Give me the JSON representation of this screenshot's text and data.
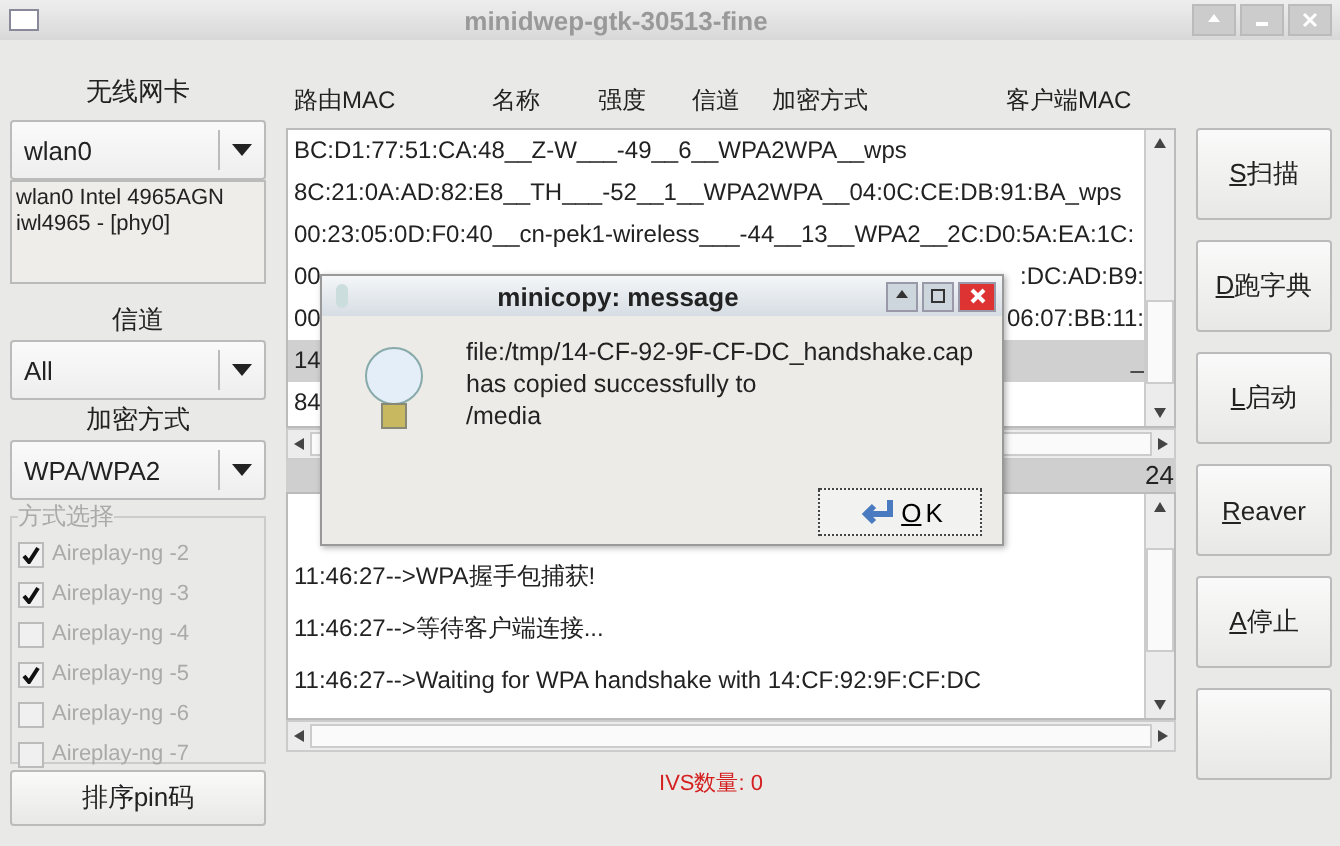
{
  "window": {
    "title": "minidwep-gtk-30513-fine"
  },
  "sidebar": {
    "adapter_label": "无线网卡",
    "adapter": "wlan0",
    "adapter_info": [
      "wlan0 Intel 4965AGN",
      "iwl4965 - [phy0]"
    ],
    "channel_label": "信道",
    "channel": "All",
    "encryption_label": "加密方式",
    "encryption": "WPA/WPA2",
    "methods_label": "方式选择",
    "methods": [
      {
        "label": "Aireplay-ng -2",
        "checked": true,
        "disabled": true
      },
      {
        "label": "Aireplay-ng -3",
        "checked": true,
        "disabled": true
      },
      {
        "label": "Aireplay-ng -4",
        "checked": false,
        "disabled": true
      },
      {
        "label": "Aireplay-ng -5",
        "checked": true,
        "disabled": true
      },
      {
        "label": "Aireplay-ng -6",
        "checked": false,
        "disabled": true
      },
      {
        "label": "Aireplay-ng -7",
        "checked": false,
        "disabled": true
      }
    ],
    "pin_button": "排序pin码"
  },
  "table": {
    "columns": [
      "路由MAC",
      "名称",
      "强度",
      "信道",
      "加密方式",
      "客户端MAC"
    ],
    "rows": [
      {
        "text": "BC:D1:77:51:CA:48__Z-W___-49__6__WPA2WPA__wps",
        "selected": false
      },
      {
        "text": "8C:21:0A:AD:82:E8__TH___-52__1__WPA2WPA__04:0C:CE:DB:91:BA_wps",
        "selected": false
      },
      {
        "text": "00:23:05:0D:F0:40__cn-pek1-wireless___-44__13__WPA2__2C:D0:5A:EA:1C:",
        "selected": false
      },
      {
        "text": "00",
        "tail": ":DC:AD:B9:",
        "selected": false
      },
      {
        "text": "00",
        "tail": "06:07:BB:11:",
        "selected": false
      },
      {
        "text": "14",
        "tail": "_",
        "selected": true
      },
      {
        "text": "84",
        "selected": false
      }
    ]
  },
  "counter": "24",
  "log": {
    "lines": [
      "11:46:27-->WPA握手包捕获!",
      "11:46:27-->等待客户端连接...",
      "11:46:27-->Waiting for WPA handshake with 14:CF:92:9F:CF:DC"
    ]
  },
  "buttons": [
    {
      "key": "S",
      "label": "扫描"
    },
    {
      "key": "D",
      "label": "跑字典"
    },
    {
      "key": "L",
      "label": "启动"
    },
    {
      "key": "R",
      "label": "eaver"
    },
    {
      "key": "A",
      "label": "停止"
    }
  ],
  "status_bar": {
    "ivs": "IVS数量: 0"
  },
  "dialog": {
    "title": "minicopy: message",
    "message": [
      "file:/tmp/14-CF-92-9F-CF-DC_handshake.cap",
      "has copied successfully to",
      "/media"
    ],
    "ok": {
      "key": "O",
      "label": "K"
    }
  }
}
